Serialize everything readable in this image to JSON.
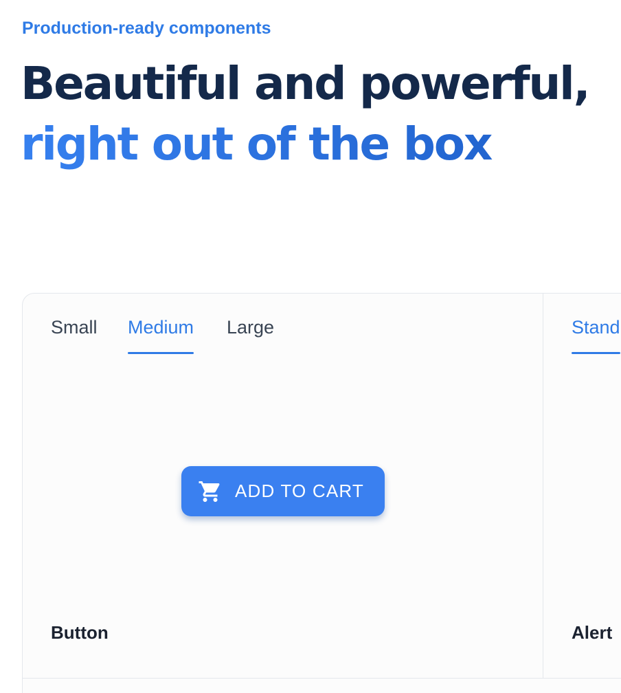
{
  "header": {
    "eyebrow": "Production-ready components",
    "headline_line1": "Beautiful and powerful,",
    "headline_line2": "right out of the box"
  },
  "button_demo": {
    "tabs": [
      {
        "label": "Small",
        "active": false
      },
      {
        "label": "Medium",
        "active": true
      },
      {
        "label": "Large",
        "active": false
      }
    ],
    "button_label": "ADD TO CART",
    "button_icon": "shopping-cart-icon",
    "title": "Button"
  },
  "alert_demo": {
    "tabs": [
      {
        "label": "Stand",
        "active": true
      }
    ],
    "title": "Alert"
  },
  "colors": {
    "accent": "#2f7be6",
    "headline_dark": "#14294a",
    "button_bg": "#3a80f0"
  }
}
